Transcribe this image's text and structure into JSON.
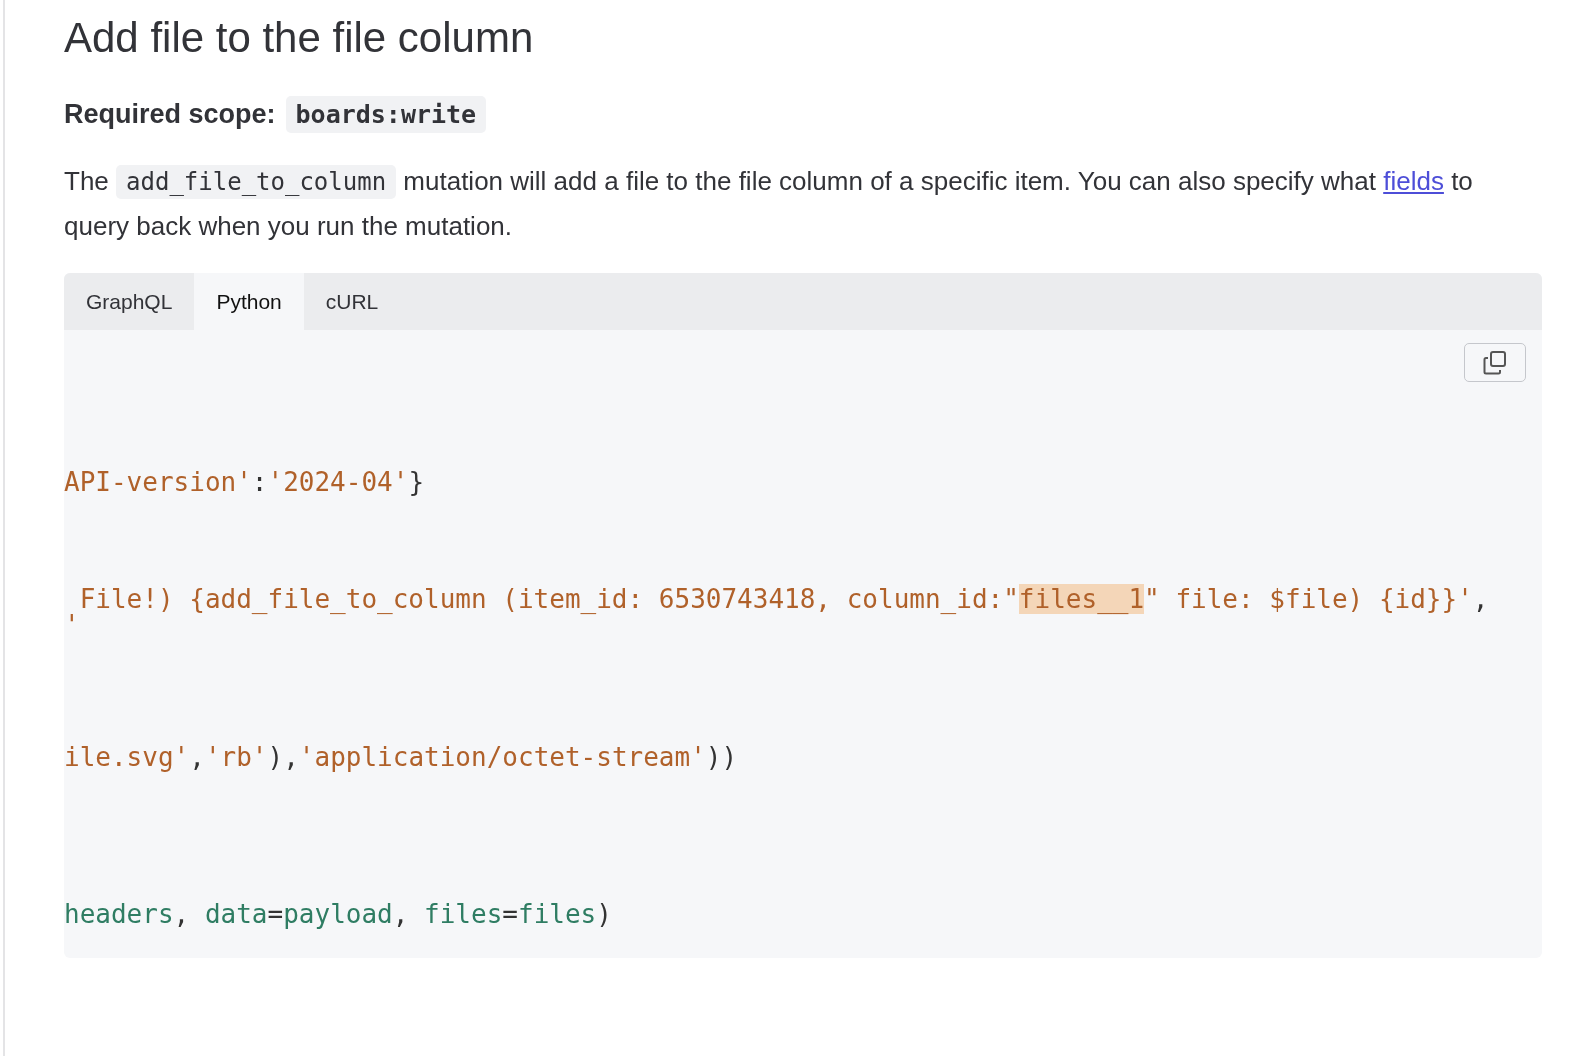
{
  "heading": "Add file to the file column",
  "scope": {
    "label": "Required scope:",
    "value": "boards:write"
  },
  "intro": [
    {
      "kind": "text",
      "text": "The "
    },
    {
      "kind": "code",
      "text": "add_file_to_column"
    },
    {
      "kind": "text",
      "text": " mutation will add a file to the file column of a specific item. You can also specify what "
    },
    {
      "kind": "link",
      "text": "fields"
    },
    {
      "kind": "text",
      "text": " to query back when you run the mutation."
    }
  ],
  "tabs": [
    {
      "label": "GraphQL",
      "selected": false
    },
    {
      "label": "Python",
      "selected": true
    },
    {
      "label": "cURL",
      "selected": false
    }
  ],
  "code_lines": [
    [
      {
        "kind": "string",
        "text": "API-version'"
      },
      {
        "kind": "punct",
        "text": ":"
      },
      {
        "kind": "string",
        "text": "'2024-04'"
      },
      {
        "kind": "punct",
        "text": "}"
      }
    ],
    [
      {
        "kind": "string",
        "text": " File!) {add_file_to_column (item_id: 6530743418, column_id:\""
      },
      {
        "kind": "highlight",
        "text": "files__1"
      },
      {
        "kind": "string",
        "text": "\" file: $file) {id}}'"
      },
      {
        "kind": "punct",
        "text": ","
      }
    ],
    [
      {
        "kind": "string",
        "text": "'"
      }
    ],
    [
      {
        "kind": "string",
        "text": "ile.svg'"
      },
      {
        "kind": "punct",
        "text": ","
      },
      {
        "kind": "string",
        "text": "'rb'"
      },
      {
        "kind": "punct",
        "text": "),"
      },
      {
        "kind": "string",
        "text": "'application/octet-stream'"
      },
      {
        "kind": "punct",
        "text": "))"
      }
    ],
    [
      {
        "kind": "name",
        "text": "headers"
      },
      {
        "kind": "punct",
        "text": ", "
      },
      {
        "kind": "name",
        "text": "data"
      },
      {
        "kind": "punct",
        "text": "="
      },
      {
        "kind": "name",
        "text": "payload"
      },
      {
        "kind": "punct",
        "text": ", "
      },
      {
        "kind": "name",
        "text": "files"
      },
      {
        "kind": "punct",
        "text": "="
      },
      {
        "kind": "name",
        "text": "files"
      },
      {
        "kind": "punct",
        "text": ")"
      }
    ]
  ]
}
